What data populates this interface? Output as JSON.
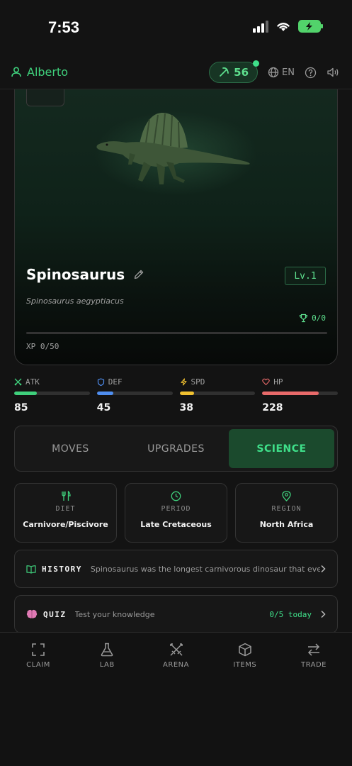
{
  "status_bar": {
    "time": "7:53"
  },
  "header": {
    "username": "Alberto",
    "energy": "56",
    "language": "EN"
  },
  "dino": {
    "name": "Spinosaurus",
    "scientific_name": "Spinosaurus aegyptiacus",
    "level": "Lv.1",
    "trophies": "0/0",
    "xp_label": "XP 0/50",
    "xp_progress": 0
  },
  "stats": [
    {
      "label": "ATK",
      "value": "85",
      "fill_fraction": 0.3,
      "color": "#3fd07c",
      "icon": "swords-icon"
    },
    {
      "label": "DEF",
      "value": "45",
      "fill_fraction": 0.22,
      "color": "#4f8ef0",
      "icon": "shield-icon"
    },
    {
      "label": "SPD",
      "value": "38",
      "fill_fraction": 0.19,
      "color": "#f0c030",
      "icon": "lightning-icon"
    },
    {
      "label": "HP",
      "value": "228",
      "fill_fraction": 0.75,
      "color": "#e86a6a",
      "icon": "heart-icon"
    }
  ],
  "tabs": [
    {
      "label": "MOVES",
      "active": false
    },
    {
      "label": "UPGRADES",
      "active": false
    },
    {
      "label": "SCIENCE",
      "active": true
    }
  ],
  "info": [
    {
      "label": "DIET",
      "value": "Carnivore/Piscivore",
      "icon": "fork-knife-icon"
    },
    {
      "label": "PERIOD",
      "value": "Late Cretaceous",
      "icon": "clock-icon"
    },
    {
      "label": "REGION",
      "value": "North Africa",
      "icon": "map-pin-icon"
    }
  ],
  "history": {
    "title": "HISTORY",
    "text": "Spinosaurus was the longest carnivorous dinosaur that ever ..."
  },
  "quiz": {
    "title": "QUIZ",
    "text": "Test your knowledge",
    "count": "0/5 today"
  },
  "nav": [
    {
      "label": "CLAIM",
      "icon": "scan-icon"
    },
    {
      "label": "LAB",
      "icon": "flask-icon"
    },
    {
      "label": "ARENA",
      "icon": "swords-icon"
    },
    {
      "label": "ITEMS",
      "icon": "cube-icon"
    },
    {
      "label": "TRADE",
      "icon": "arrows-exchange-icon"
    }
  ],
  "colors": {
    "accent": "#3fe08a",
    "background": "#131313",
    "card": "#171717"
  }
}
